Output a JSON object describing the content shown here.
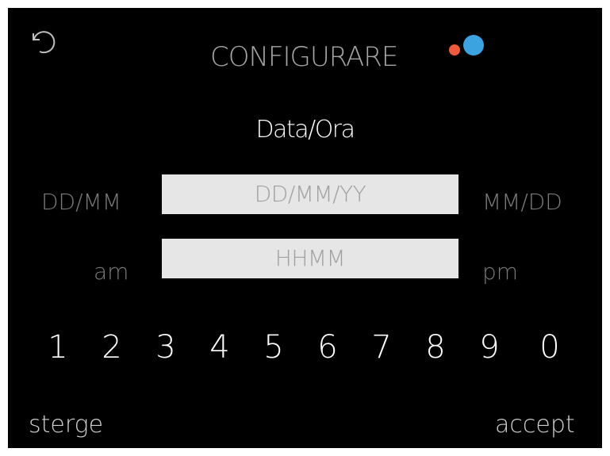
{
  "header": {
    "title": "CONFIGURARE",
    "back_icon": "undo-arrow-icon",
    "status_colors": {
      "red": "#f05a3c",
      "blue": "#3aa3e0"
    }
  },
  "subtitle": "Data/Ora",
  "date_row": {
    "left_label": "DD/MM",
    "placeholder": "DD/MM/YY",
    "right_label": "MM/DD"
  },
  "time_row": {
    "left_label": "am",
    "placeholder": "HHMM",
    "right_label": "pm"
  },
  "keypad": [
    "1",
    "2",
    "3",
    "4",
    "5",
    "6",
    "7",
    "8",
    "9",
    "0"
  ],
  "footer": {
    "clear_label": "sterge",
    "accept_label": "accept"
  }
}
